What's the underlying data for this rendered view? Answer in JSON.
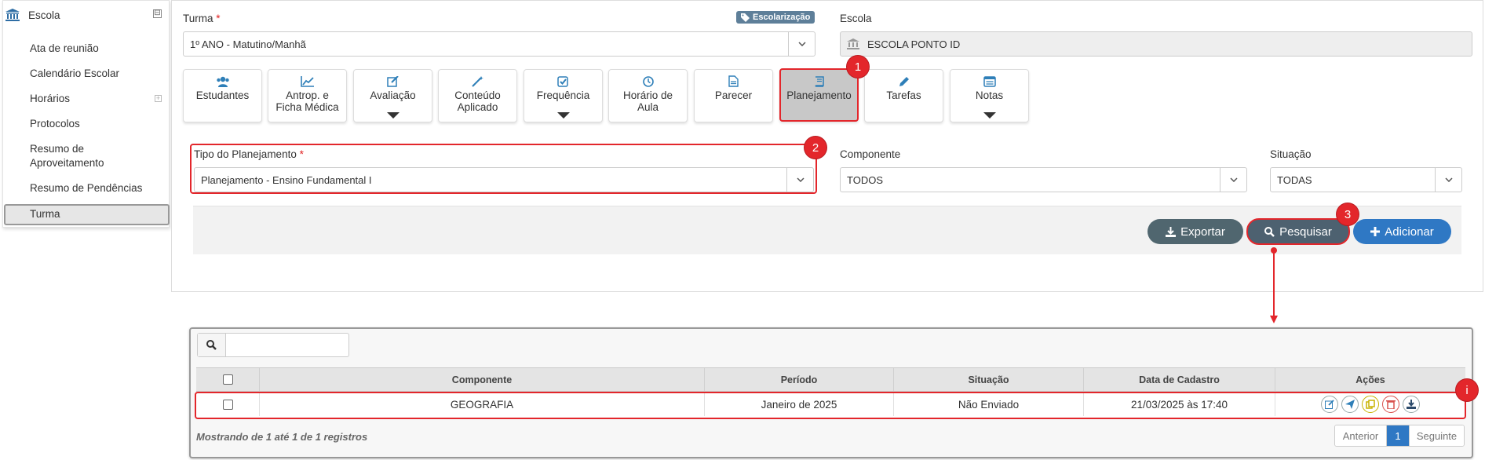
{
  "sidebar": {
    "title": "Escola",
    "collapse_symbol": "⊟",
    "expand_symbol": "+",
    "items": [
      {
        "label": "Ata de reunião"
      },
      {
        "label": "Calendário Escolar"
      },
      {
        "label": "Horários"
      },
      {
        "label": "Protocolos"
      },
      {
        "label": "Resumo de Aproveitamento"
      },
      {
        "label": "Resumo de Pendências"
      },
      {
        "label": "Turma",
        "active": true
      }
    ]
  },
  "form": {
    "turma_label": "Turma",
    "required_mark": "*",
    "turma_badge": "Escolarização",
    "turma_value": "1º ANO - Matutino/Manhã",
    "escola_label": "Escola",
    "escola_value": "ESCOLA PONTO ID",
    "tipo_label": "Tipo do Planejamento",
    "tipo_value": "Planejamento - Ensino Fundamental I",
    "componente_label": "Componente",
    "componente_value": "TODOS",
    "situacao_label": "Situação",
    "situacao_value": "TODAS"
  },
  "tiles": [
    {
      "label": "Estudantes",
      "icon": "users-icon"
    },
    {
      "label": "Antrop. e Ficha Médica",
      "icon": "chart-line-icon"
    },
    {
      "label": "Avaliação",
      "icon": "edit-icon",
      "dropdown": true
    },
    {
      "label": "Conteúdo Aplicado",
      "icon": "magic-icon"
    },
    {
      "label": "Frequência",
      "icon": "check-square-icon",
      "dropdown": true
    },
    {
      "label": "Horário de Aula",
      "icon": "clock-icon"
    },
    {
      "label": "Parecer",
      "icon": "file-text-icon"
    },
    {
      "label": "Planejamento",
      "icon": "book-icon",
      "active": true
    },
    {
      "label": "Tarefas",
      "icon": "pencil-icon"
    },
    {
      "label": "Notas",
      "icon": "list-icon",
      "dropdown": true
    }
  ],
  "buttons": {
    "exportar": "Exportar",
    "pesquisar": "Pesquisar",
    "adicionar": "Adicionar"
  },
  "steps": {
    "one": "1",
    "two": "2",
    "three": "3",
    "info": "i"
  },
  "table": {
    "search_value": "",
    "columns": [
      "Componente",
      "Período",
      "Situação",
      "Data de Cadastro",
      "Ações"
    ],
    "rows": [
      {
        "componente": "GEOGRAFIA",
        "periodo": "Janeiro de 2025",
        "situacao": "Não Enviado",
        "data": "21/03/2025 às 17:40"
      }
    ],
    "footer": "Mostrando de 1 até 1 de 1 registros",
    "pager": {
      "prev": "Anterior",
      "current": "1",
      "next": "Seguinte"
    }
  },
  "colors": {
    "highlight": "#e3262b",
    "exportar": "#50666f",
    "pesquisar": "#4d6170",
    "adicionar": "#2f78c4",
    "badge": "#5e7f99"
  }
}
